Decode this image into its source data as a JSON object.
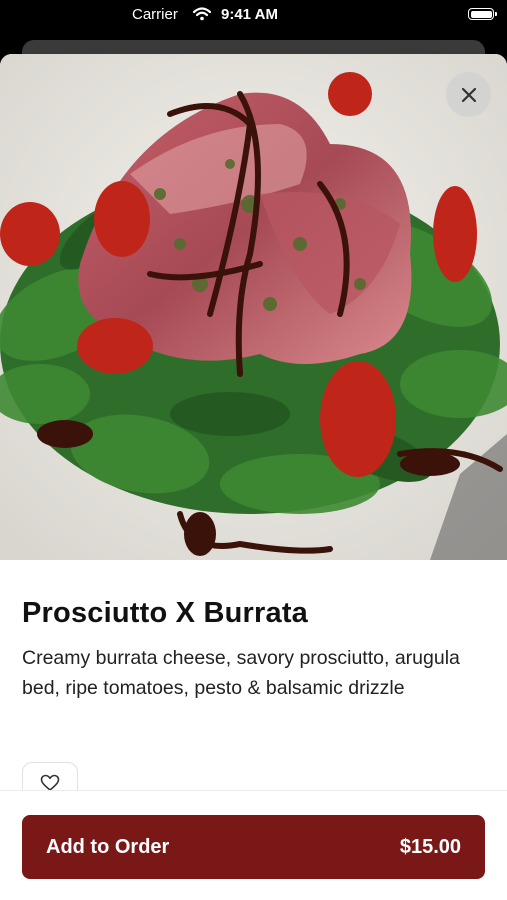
{
  "status_bar": {
    "carrier": "Carrier",
    "time": "9:41 AM"
  },
  "item": {
    "title": "Prosciutto X Burrata",
    "description": "Creamy burrata cheese, savory prosciutto, arugula bed, ripe tomatoes, pesto & balsamic drizzle",
    "image_icon": "food-photo"
  },
  "actions": {
    "close_icon": "close-icon",
    "favorite_icon": "heart-icon",
    "add_label": "Add to Order",
    "price": "$15.00"
  },
  "colors": {
    "accent": "#7a1818",
    "text": "#111111"
  }
}
